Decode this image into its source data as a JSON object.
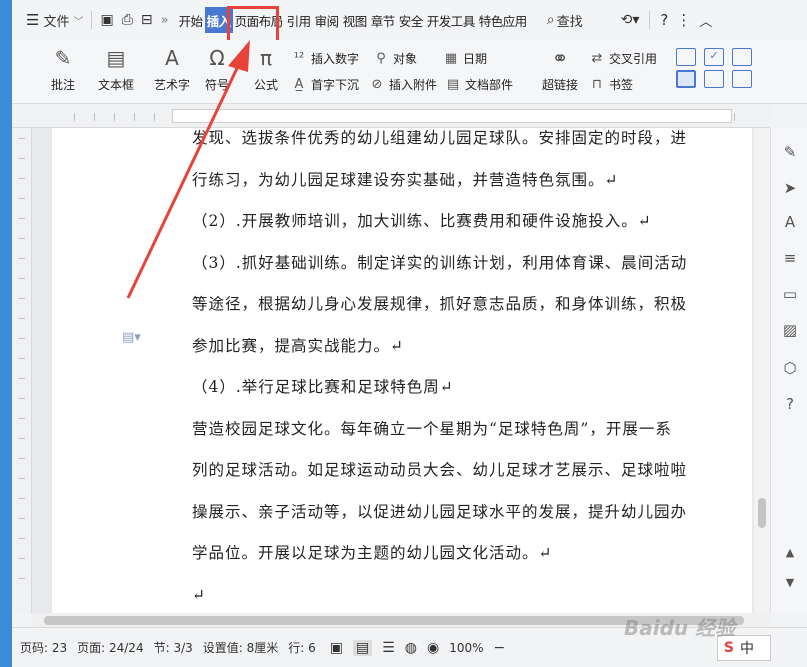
{
  "menubar": {
    "file_label": "文件",
    "tabs": [
      "开始",
      "插入",
      "页面布局",
      "引用",
      "审阅",
      "视图",
      "章节",
      "安全",
      "开发工具",
      "特色应用"
    ],
    "active_tab": "插入",
    "search_label": "查找"
  },
  "ribbon": {
    "comment": "批注",
    "textbox": "文本框",
    "wordart": "艺术字",
    "symbol": "符号",
    "formula": "公式",
    "insert_number": "插入数字",
    "object": "对象",
    "date": "日期",
    "drop_cap": "首字下沉",
    "insert_attachment": "插入附件",
    "doc_parts": "文档部件",
    "hyperlink": "超链接",
    "cross_ref": "交叉引用",
    "bookmark": "书签"
  },
  "document": {
    "lines": [
      "发现、选拔条件优秀的幼儿组建幼儿园足球队。安排固定的时段，进",
      "行练习，为幼儿园足球建设夯实基础，并营造特色氛围。↵",
      "（2）.开展教师培训，加大训练、比赛费用和硬件设施投入。↵",
      "（3）.抓好基础训练。制定详实的训练计划，利用体育课、晨间活动",
      "等途径，根据幼儿身心发展规律，抓好意志品质，和身体训练，积极",
      "参加比赛，提高实战能力。↵",
      "（4）.举行足球比赛和足球特色周↵",
      "营造校园足球文化。每年确立一个星期为“足球特色周”，开展一系",
      "列的足球活动。如足球运动动员大会、幼儿足球才艺展示、足球啦啦",
      "操展示、亲子活动等，以促进幼儿园足球水平的发展，提升幼儿园办",
      "学品位。开展以足球为主题的幼儿园文化活动。↵",
      "↵"
    ]
  },
  "status": {
    "page_code": "页码: 23",
    "page": "页面: 24/24",
    "section": "节: 3/3",
    "setting": "设置值: 8厘米",
    "row": "行: 6",
    "zoom": "100%"
  },
  "ime": {
    "label": "中"
  },
  "watermark": "Baidu 经验",
  "colors": {
    "accent": "#4a78d0",
    "highlight": "#e8433a"
  }
}
